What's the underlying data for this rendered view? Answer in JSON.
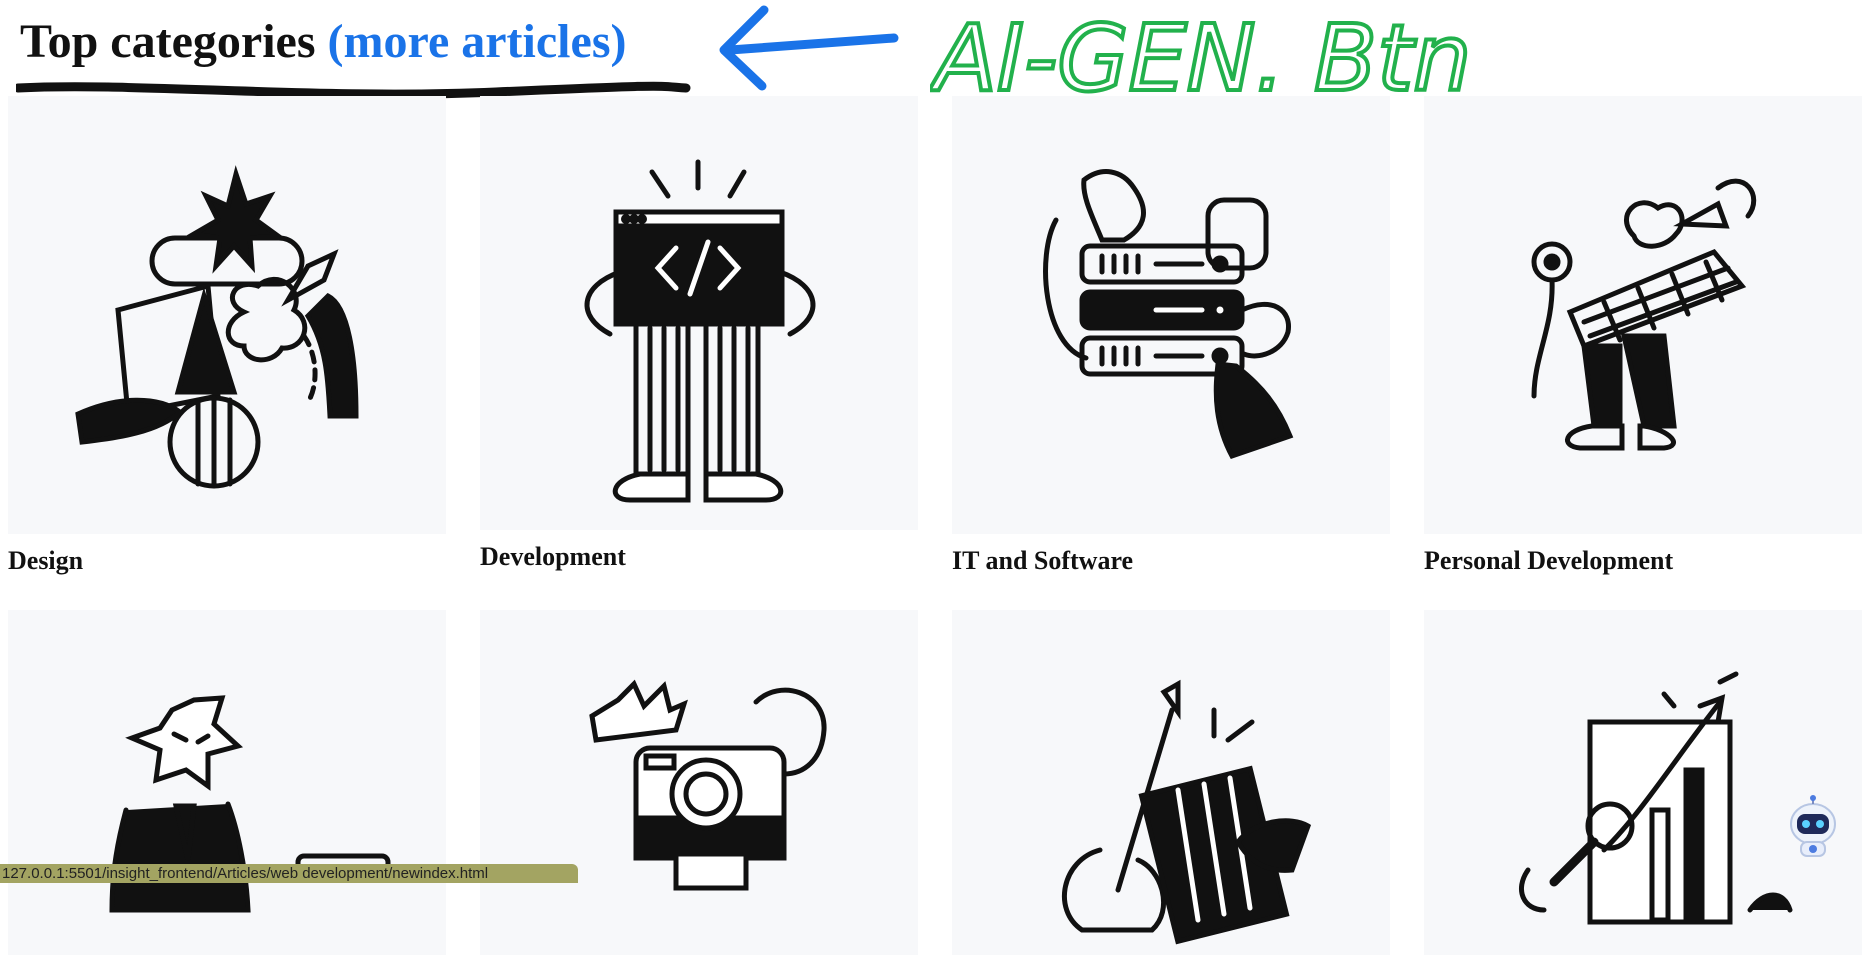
{
  "header": {
    "title": "Top categories",
    "more_link": "(more articles)"
  },
  "annotation": {
    "text": "AI-GEN. Btn",
    "color": "#22b14c",
    "arrow_color": "#1a73e8"
  },
  "categories_row1": [
    {
      "label": "Design",
      "icon": "design-illustration"
    },
    {
      "label": "Development",
      "icon": "code-window-illustration"
    },
    {
      "label": "IT and Software",
      "icon": "server-rack-illustration"
    },
    {
      "label": "Personal Development",
      "icon": "person-flower-illustration"
    }
  ],
  "categories_row2": [
    {
      "icon": "star-person-illustration"
    },
    {
      "icon": "camera-illustration"
    },
    {
      "icon": "guitar-piano-illustration"
    },
    {
      "icon": "chart-magnifier-illustration"
    }
  ],
  "status_bar": {
    "url": "127.0.0.1:5501/insight_frontend/Articles/web development/newindex.html"
  },
  "chatbot": {
    "icon": "robot-assistant-icon"
  },
  "colors": {
    "card_bg": "#f7f8fa",
    "link": "#1a73e8",
    "status_bg": "#a3a462"
  }
}
